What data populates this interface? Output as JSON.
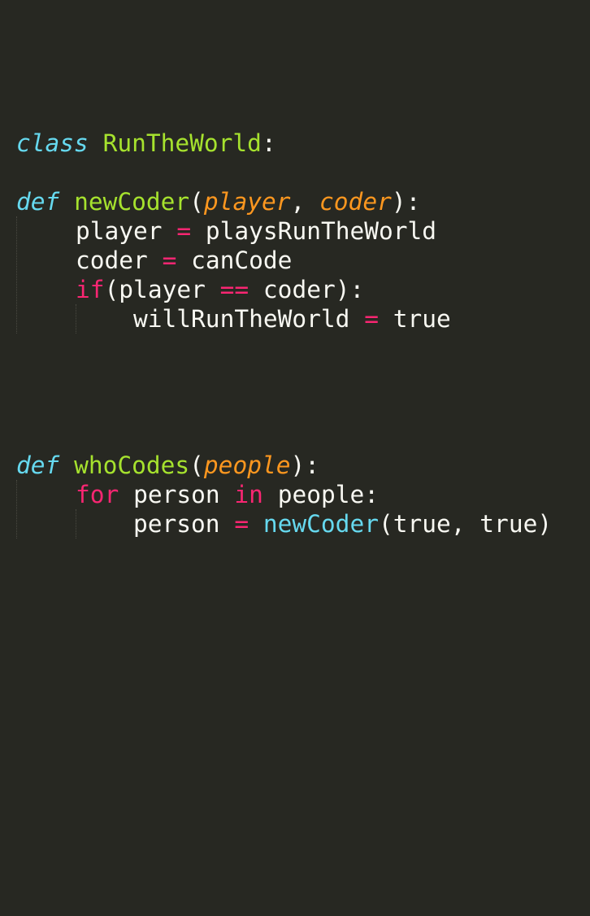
{
  "theme": {
    "background": "#272822",
    "foreground": "#F8F8F2",
    "storage": "#66D9EF",
    "control": "#F92672",
    "entity": "#A6E22E",
    "parameter": "#FD971F",
    "support_function": "#66D9EF",
    "indent_guide": "#4a4a42"
  },
  "code": {
    "line1": {
      "kw": "class",
      "name": "RunTheWorld",
      "colon": ":"
    },
    "line2": {
      "kw": "def",
      "name": "newCoder",
      "open": "(",
      "p1": "player",
      "comma": ", ",
      "p2": "coder",
      "close": "):"
    },
    "line3": {
      "lhs": "player",
      "op": "=",
      "rhs": "playsRunTheWorld"
    },
    "line4": {
      "lhs": "coder",
      "op": "=",
      "rhs": "canCode"
    },
    "line5": {
      "kw": "if",
      "open": "(player",
      "op": "==",
      "rest": "coder):"
    },
    "line6": {
      "lhs": "willRunTheWorld",
      "op": "=",
      "rhs": "true"
    },
    "line7": {
      "kw": "def",
      "name": "whoCodes",
      "open": "(",
      "p1": "people",
      "close": "):"
    },
    "line8": {
      "kw": "for",
      "var": "person",
      "kw2": "in",
      "iter": "people:"
    },
    "line9": {
      "lhs": "person",
      "op": "=",
      "call": "newCoder",
      "args": "(true, true)"
    }
  }
}
